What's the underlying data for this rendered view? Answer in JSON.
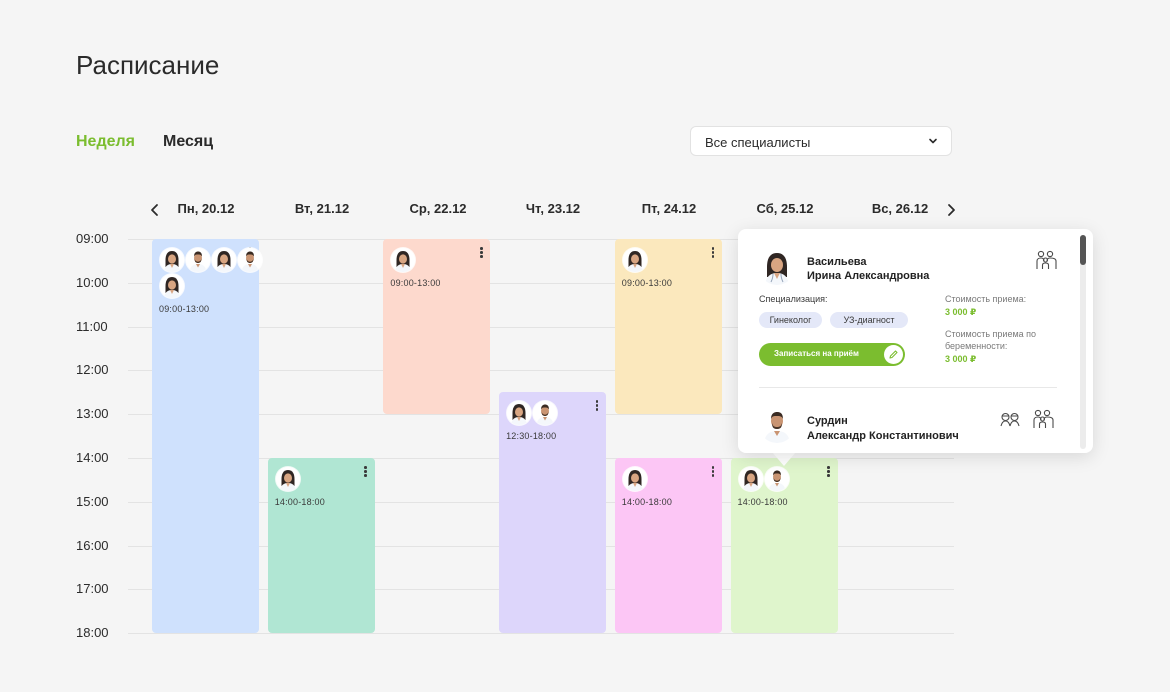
{
  "page": {
    "title": "Расписание"
  },
  "view_tabs": {
    "week": "Неделя",
    "month": "Месяц",
    "active": "week"
  },
  "filter": {
    "selected": "Все специалисты"
  },
  "days": [
    "Пн, 20.12",
    "Вт, 21.12",
    "Ср, 22.12",
    "Чт, 23.12",
    "Пт, 24.12",
    "Сб, 25.12",
    "Вс, 26.12"
  ],
  "times": [
    "09:00",
    "10:00",
    "11:00",
    "12:00",
    "13:00",
    "14:00",
    "15:00",
    "16:00",
    "17:00",
    "18:00"
  ],
  "blocks": [
    {
      "day": 0,
      "start": 9.0,
      "end": 18.0,
      "color": "#cfe1fd",
      "time": "09:00-13:00",
      "avatars": [
        "female",
        "male",
        "female",
        "male",
        "female"
      ]
    },
    {
      "day": 1,
      "start": 14.0,
      "end": 18.0,
      "color": "#b0e6d3",
      "time": "14:00-18:00",
      "avatars": [
        "female"
      ]
    },
    {
      "day": 2,
      "start": 9.0,
      "end": 13.0,
      "color": "#fdd9cd",
      "time": "09:00-13:00",
      "avatars": [
        "female"
      ]
    },
    {
      "day": 3,
      "start": 12.5,
      "end": 18.0,
      "color": "#ddd6fb",
      "time": "12:30-18:00",
      "avatars": [
        "female",
        "male"
      ]
    },
    {
      "day": 4,
      "start": 9.0,
      "end": 13.0,
      "color": "#fbe8bd",
      "time": "09:00-13:00",
      "avatars": [
        "female"
      ]
    },
    {
      "day": 4,
      "start": 14.0,
      "end": 18.0,
      "color": "#fcc6f5",
      "time": "14:00-18:00",
      "avatars": [
        "female"
      ]
    },
    {
      "day": 5,
      "start": 14.0,
      "end": 18.0,
      "color": "#dff5cc",
      "time": "14:00-18:00",
      "avatars": [
        "female",
        "male"
      ]
    }
  ],
  "popup": {
    "doctors": [
      {
        "last_name": "Васильева",
        "first_names": "Ирина Александровна",
        "spec_label": "Специализация:",
        "specs": [
          "Гинеколог",
          "УЗ-диагност"
        ],
        "price_label": "Стоимость приема:",
        "price": "3 000 ₽",
        "pregnancy_price_label": "Стоимость приема по беременности:",
        "pregnancy_price": "3 000 ₽",
        "book_label": "Записаться на приём",
        "icon": "family-icon",
        "gender": "female"
      },
      {
        "last_name": "Сурдин",
        "first_names": "Александр Константинович",
        "icons": [
          "elderly-couple-icon",
          "family-icon"
        ],
        "gender": "male"
      }
    ]
  },
  "colors": {
    "accent": "#7bbd2f",
    "grid": "#e3e3e3",
    "background": "#f5f5f5"
  }
}
